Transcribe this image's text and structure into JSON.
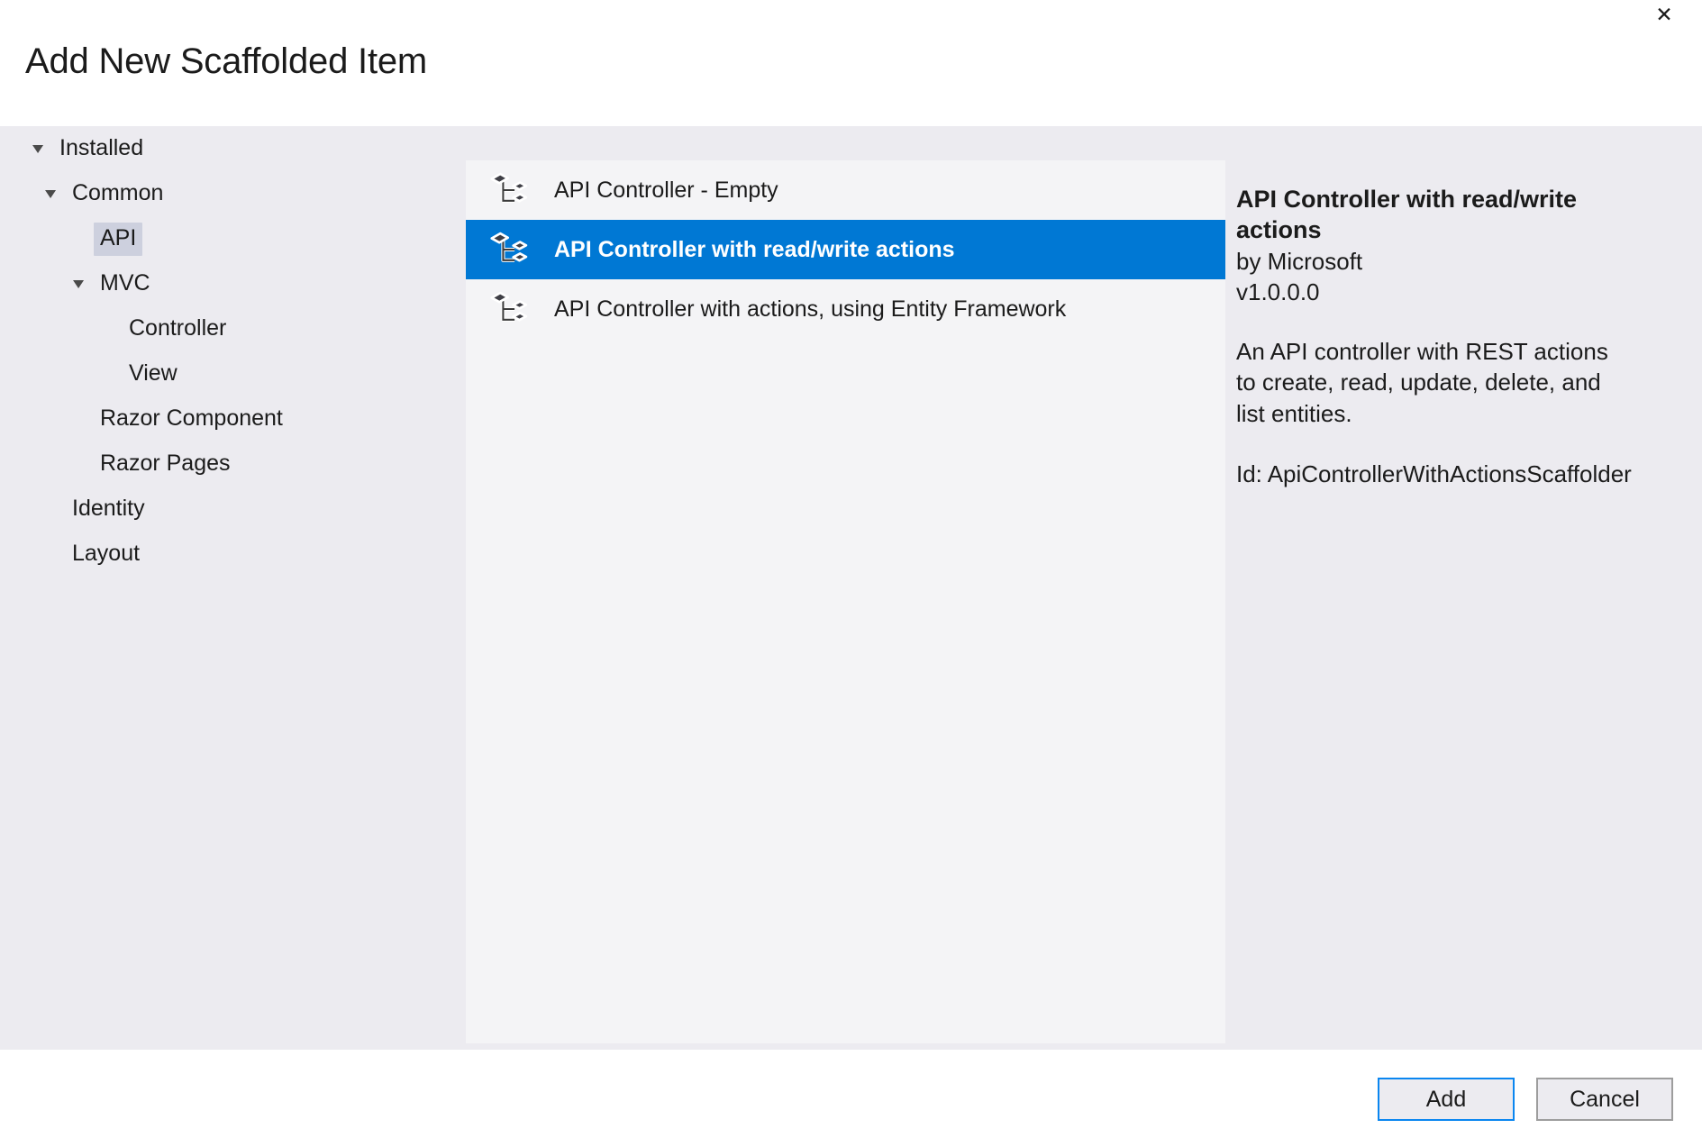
{
  "window": {
    "title": "Add New Scaffolded Item",
    "close_icon": "close-icon",
    "close_glyph": "✕"
  },
  "colors": {
    "accent": "#0078d4",
    "panel_background": "#ecebf0",
    "list_background": "#f4f4f6",
    "tree_selection": "#cdd0de",
    "focus_border": "#0a86f0",
    "button_border": "#9d9d9d",
    "text": "#1b1b1b"
  },
  "tree": {
    "nodes": [
      {
        "label": "Installed",
        "level": 0,
        "expandable": true,
        "expanded": true,
        "selected": false
      },
      {
        "label": "Common",
        "level": 1,
        "expandable": true,
        "expanded": true,
        "selected": false
      },
      {
        "label": "API",
        "level": 2,
        "expandable": false,
        "expanded": false,
        "selected": true
      },
      {
        "label": "MVC",
        "level": 2,
        "expandable": true,
        "expanded": true,
        "selected": false
      },
      {
        "label": "Controller",
        "level": 3,
        "expandable": false,
        "expanded": false,
        "selected": false
      },
      {
        "label": "View",
        "level": 3,
        "expandable": false,
        "expanded": false,
        "selected": false
      },
      {
        "label": "Razor Component",
        "level": 2,
        "expandable": false,
        "expanded": false,
        "selected": false
      },
      {
        "label": "Razor Pages",
        "level": 2,
        "expandable": false,
        "expanded": false,
        "selected": false
      },
      {
        "label": "Identity",
        "level": 1,
        "expandable": false,
        "expanded": false,
        "selected": false
      },
      {
        "label": "Layout",
        "level": 1,
        "expandable": false,
        "expanded": false,
        "selected": false
      }
    ]
  },
  "list": {
    "icon_name": "scaffold-hierarchy-icon",
    "items": [
      {
        "label": "API Controller - Empty",
        "selected": false
      },
      {
        "label": "API Controller with read/write actions",
        "selected": true
      },
      {
        "label": "API Controller with actions, using Entity Framework",
        "selected": false
      }
    ]
  },
  "details": {
    "title": "API Controller with read/write actions",
    "author": "by Microsoft",
    "version": "v1.0.0.0",
    "description": "An API controller with REST actions to create, read, update, delete, and list entities.",
    "id": "Id: ApiControllerWithActionsScaffolder"
  },
  "footer": {
    "add_label": "Add",
    "cancel_label": "Cancel"
  }
}
